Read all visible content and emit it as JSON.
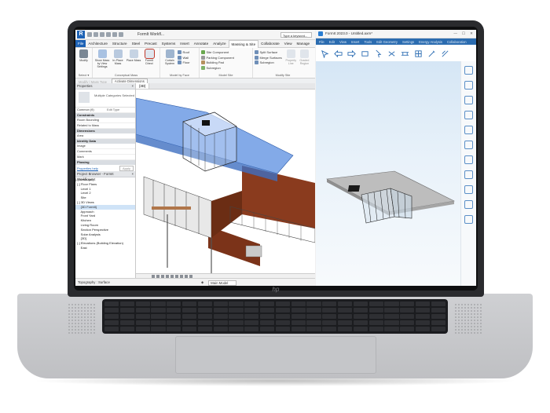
{
  "device": {
    "brand_mark": "hp"
  },
  "revit": {
    "title": {
      "doc": "FormIt Workfl...",
      "search_placeholder": "Type a keyword..."
    },
    "tabs": [
      "File",
      "Architecture",
      "Structure",
      "Steel",
      "Precast",
      "Systems",
      "Insert",
      "Annotate",
      "Analyze",
      "Massing & Site",
      "Collaborate",
      "View",
      "Manage"
    ],
    "active_tab": "Massing & Site",
    "ribbon": {
      "modify": "Modify",
      "select_label": "Select ▾",
      "conceptual_mass": {
        "buttons": [
          "Show Mass by View Settings",
          "In-Place Mass",
          "Place Mass",
          "FormIt Direct"
        ],
        "group_label": "Conceptual Mass"
      },
      "model_by_face": {
        "buttons": [
          "Curtain System",
          "Roof",
          "Wall",
          "Floor"
        ],
        "group_label": "Model by Face"
      },
      "model_site": {
        "items": [
          "Site Component",
          "Parking Component",
          "Building Pad",
          "Subregion",
          "Toposurface"
        ],
        "group_label": "Model Site"
      },
      "modify_site": {
        "items": [
          "Split Surface",
          "Merge Surfaces",
          "Subregion"
        ],
        "buttons": [
          "Property Line",
          "Graded Region",
          "Label Contours"
        ],
        "group_label": "Modify Site"
      }
    },
    "option_bar": {
      "text": "Modify | Mass Type",
      "button": "Activate Dimensions"
    },
    "properties": {
      "header": "Properties",
      "type_text": "Multiple Categories Selected",
      "common": "Common (9)",
      "edit_type": "Edit Type",
      "sections": [
        {
          "name": "Constraints",
          "rows": [
            [
              "Room Bounding",
              ""
            ],
            [
              "Related to Mass",
              ""
            ]
          ]
        },
        {
          "name": "Dimensions",
          "rows": [
            [
              "Area",
              ""
            ]
          ]
        },
        {
          "name": "Identity Data",
          "rows": [
            [
              "Image",
              ""
            ],
            [
              "Comments",
              ""
            ],
            [
              "Mark",
              ""
            ]
          ]
        },
        {
          "name": "Phasing",
          "rows": []
        }
      ],
      "help_link": "Properties help",
      "apply": "Apply"
    },
    "project_browser": {
      "header": "Project Browser - FormIt Workflow.rvt",
      "items": [
        "[-] Views (all)",
        "  [-] Floor Plans",
        "      Level 1",
        "      Level 2",
        "      Site",
        "  [-] 3D Views",
        "      {3D FormIt}",
        "      Approach",
        "      Front Yard",
        "      Kitchen",
        "      Living Room",
        "      Section Perspective",
        "      Solar Analysis",
        "      {3D}",
        "  [-] Elevations (Building Elevation)",
        "      East"
      ],
      "selected_index": 6
    },
    "view_tab": "{3D}",
    "status": {
      "left": "Topography : Surface",
      "model": "Main Model"
    }
  },
  "formit": {
    "title": "FormIt 2023.0 - Untitled.axm*",
    "menu": [
      "File",
      "Edit",
      "View",
      "Insert",
      "Tools",
      "Edit Geometry",
      "Settings",
      "Energy Analysis",
      "Collaboration"
    ],
    "tools": [
      "select-tool",
      "push-pull-tool",
      "line-tool",
      "arc-tool",
      "rectangle-tool",
      "circle-tool",
      "measure-tool",
      "paint-tool",
      "level-tool"
    ],
    "side_icons": [
      "properties-icon",
      "materials-icon",
      "layers-icon",
      "levels-icon",
      "groups-icon",
      "scenes-icon",
      "plugins-icon",
      "settings-icon",
      "zoom-in-icon",
      "zoom-out-icon",
      "help-icon"
    ]
  },
  "colors": {
    "revit_blue": "#1d62b5",
    "mass_blue": "#5a8de0",
    "cladding": "#8a3b1e",
    "formit_sky": "#d5e6f5"
  }
}
